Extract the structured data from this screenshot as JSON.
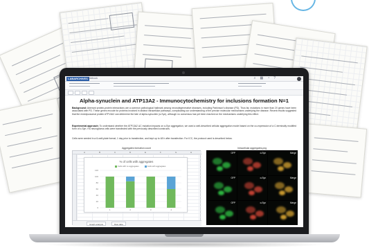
{
  "app": {
    "logo": "LABARCHIVES",
    "tab": "Notebook"
  },
  "document": {
    "title": "Alpha-synuclein and ATP13A2 - Immunocytochemistry for inclusions formation N=1",
    "background_label": "Background:",
    "background_text": "Aberrant protein-protein interactions are a common pathological hallmark among neurodegenerative diseases, including Parkinson's disease (PD). Thus far, mutations in more than 20 genes have been associated with PD. These genes encode for proteins involved in distinct intracellular pathways, complicating our understanding of the precise molecular mechanisms underlying the disease. Recent results suggested that the endolysosomal protein ATP13A2 can determine the fate of alpha-synuclein (α-Syn), although no consensus has yet been reached on the mechanisms underlying this effect.",
    "approach_label": "Experimental approach:",
    "approach_text": "To understand whether the ATP13A2 ΔC mutation impacts on α-Syn aggregation, we used a well-described cellular aggregation model based on the co-expression of a C-terminally modified form of α-Syn. H4 neuroglioma cells were transfected with the previously described constructs.",
    "method_text": "Cells were seeded in a 6-well-plate format, 1 day prior to transfection, and kept up to 48 h after transfection. For ICC, the protocol used is described below."
  },
  "spreadsheet": {
    "caption": "Aggregates formation count",
    "columns": [
      "A",
      "B",
      "C",
      "D",
      "E",
      "F",
      "G",
      "H"
    ],
    "sheet_tabs": [
      "Graph analysis",
      "Raw data"
    ]
  },
  "chart_data": {
    "type": "bar",
    "title": "% of cells with aggregates",
    "stacked": true,
    "categories": [
      "1",
      "2",
      "3",
      "4"
    ],
    "series": [
      {
        "name": "Cells with no aggregates",
        "color": "#70b95c",
        "values": [
          100,
          85,
          100,
          60
        ]
      },
      {
        "name": "Cells with aggregates",
        "color": "#5aa3d6",
        "values": [
          0,
          15,
          0,
          40
        ]
      }
    ],
    "ylim": [
      0,
      120
    ]
  },
  "microscopy": {
    "caption": "Intracellular aggregates.png",
    "rows": [
      [
        "GFP",
        "α-Syn",
        "Merge"
      ],
      [
        "GFP",
        "α-Syn",
        "Merge"
      ],
      [
        "GFP",
        "α-Syn",
        "Merge"
      ]
    ]
  }
}
